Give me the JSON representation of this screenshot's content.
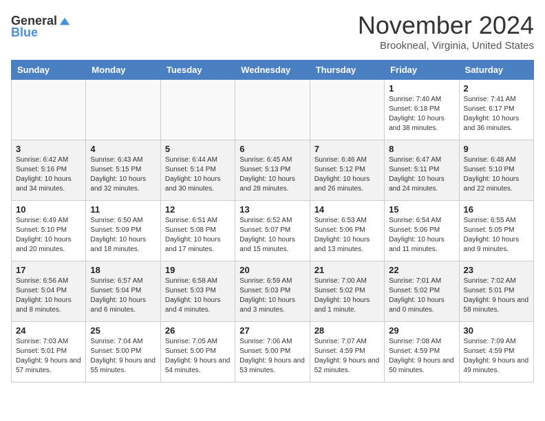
{
  "header": {
    "logo_general": "General",
    "logo_blue": "Blue",
    "month_title": "November 2024",
    "location": "Brookneal, Virginia, United States"
  },
  "weekdays": [
    "Sunday",
    "Monday",
    "Tuesday",
    "Wednesday",
    "Thursday",
    "Friday",
    "Saturday"
  ],
  "weeks": [
    [
      {
        "day": "",
        "sunrise": "",
        "sunset": "",
        "daylight": ""
      },
      {
        "day": "",
        "sunrise": "",
        "sunset": "",
        "daylight": ""
      },
      {
        "day": "",
        "sunrise": "",
        "sunset": "",
        "daylight": ""
      },
      {
        "day": "",
        "sunrise": "",
        "sunset": "",
        "daylight": ""
      },
      {
        "day": "",
        "sunrise": "",
        "sunset": "",
        "daylight": ""
      },
      {
        "day": "1",
        "sunrise": "Sunrise: 7:40 AM",
        "sunset": "Sunset: 6:18 PM",
        "daylight": "Daylight: 10 hours and 38 minutes."
      },
      {
        "day": "2",
        "sunrise": "Sunrise: 7:41 AM",
        "sunset": "Sunset: 6:17 PM",
        "daylight": "Daylight: 10 hours and 36 minutes."
      }
    ],
    [
      {
        "day": "3",
        "sunrise": "Sunrise: 6:42 AM",
        "sunset": "Sunset: 5:16 PM",
        "daylight": "Daylight: 10 hours and 34 minutes."
      },
      {
        "day": "4",
        "sunrise": "Sunrise: 6:43 AM",
        "sunset": "Sunset: 5:15 PM",
        "daylight": "Daylight: 10 hours and 32 minutes."
      },
      {
        "day": "5",
        "sunrise": "Sunrise: 6:44 AM",
        "sunset": "Sunset: 5:14 PM",
        "daylight": "Daylight: 10 hours and 30 minutes."
      },
      {
        "day": "6",
        "sunrise": "Sunrise: 6:45 AM",
        "sunset": "Sunset: 5:13 PM",
        "daylight": "Daylight: 10 hours and 28 minutes."
      },
      {
        "day": "7",
        "sunrise": "Sunrise: 6:46 AM",
        "sunset": "Sunset: 5:12 PM",
        "daylight": "Daylight: 10 hours and 26 minutes."
      },
      {
        "day": "8",
        "sunrise": "Sunrise: 6:47 AM",
        "sunset": "Sunset: 5:11 PM",
        "daylight": "Daylight: 10 hours and 24 minutes."
      },
      {
        "day": "9",
        "sunrise": "Sunrise: 6:48 AM",
        "sunset": "Sunset: 5:10 PM",
        "daylight": "Daylight: 10 hours and 22 minutes."
      }
    ],
    [
      {
        "day": "10",
        "sunrise": "Sunrise: 6:49 AM",
        "sunset": "Sunset: 5:10 PM",
        "daylight": "Daylight: 10 hours and 20 minutes."
      },
      {
        "day": "11",
        "sunrise": "Sunrise: 6:50 AM",
        "sunset": "Sunset: 5:09 PM",
        "daylight": "Daylight: 10 hours and 18 minutes."
      },
      {
        "day": "12",
        "sunrise": "Sunrise: 6:51 AM",
        "sunset": "Sunset: 5:08 PM",
        "daylight": "Daylight: 10 hours and 17 minutes."
      },
      {
        "day": "13",
        "sunrise": "Sunrise: 6:52 AM",
        "sunset": "Sunset: 5:07 PM",
        "daylight": "Daylight: 10 hours and 15 minutes."
      },
      {
        "day": "14",
        "sunrise": "Sunrise: 6:53 AM",
        "sunset": "Sunset: 5:06 PM",
        "daylight": "Daylight: 10 hours and 13 minutes."
      },
      {
        "day": "15",
        "sunrise": "Sunrise: 6:54 AM",
        "sunset": "Sunset: 5:06 PM",
        "daylight": "Daylight: 10 hours and 11 minutes."
      },
      {
        "day": "16",
        "sunrise": "Sunrise: 6:55 AM",
        "sunset": "Sunset: 5:05 PM",
        "daylight": "Daylight: 10 hours and 9 minutes."
      }
    ],
    [
      {
        "day": "17",
        "sunrise": "Sunrise: 6:56 AM",
        "sunset": "Sunset: 5:04 PM",
        "daylight": "Daylight: 10 hours and 8 minutes."
      },
      {
        "day": "18",
        "sunrise": "Sunrise: 6:57 AM",
        "sunset": "Sunset: 5:04 PM",
        "daylight": "Daylight: 10 hours and 6 minutes."
      },
      {
        "day": "19",
        "sunrise": "Sunrise: 6:58 AM",
        "sunset": "Sunset: 5:03 PM",
        "daylight": "Daylight: 10 hours and 4 minutes."
      },
      {
        "day": "20",
        "sunrise": "Sunrise: 6:59 AM",
        "sunset": "Sunset: 5:03 PM",
        "daylight": "Daylight: 10 hours and 3 minutes."
      },
      {
        "day": "21",
        "sunrise": "Sunrise: 7:00 AM",
        "sunset": "Sunset: 5:02 PM",
        "daylight": "Daylight: 10 hours and 1 minute."
      },
      {
        "day": "22",
        "sunrise": "Sunrise: 7:01 AM",
        "sunset": "Sunset: 5:02 PM",
        "daylight": "Daylight: 10 hours and 0 minutes."
      },
      {
        "day": "23",
        "sunrise": "Sunrise: 7:02 AM",
        "sunset": "Sunset: 5:01 PM",
        "daylight": "Daylight: 9 hours and 58 minutes."
      }
    ],
    [
      {
        "day": "24",
        "sunrise": "Sunrise: 7:03 AM",
        "sunset": "Sunset: 5:01 PM",
        "daylight": "Daylight: 9 hours and 57 minutes."
      },
      {
        "day": "25",
        "sunrise": "Sunrise: 7:04 AM",
        "sunset": "Sunset: 5:00 PM",
        "daylight": "Daylight: 9 hours and 55 minutes."
      },
      {
        "day": "26",
        "sunrise": "Sunrise: 7:05 AM",
        "sunset": "Sunset: 5:00 PM",
        "daylight": "Daylight: 9 hours and 54 minutes."
      },
      {
        "day": "27",
        "sunrise": "Sunrise: 7:06 AM",
        "sunset": "Sunset: 5:00 PM",
        "daylight": "Daylight: 9 hours and 53 minutes."
      },
      {
        "day": "28",
        "sunrise": "Sunrise: 7:07 AM",
        "sunset": "Sunset: 4:59 PM",
        "daylight": "Daylight: 9 hours and 52 minutes."
      },
      {
        "day": "29",
        "sunrise": "Sunrise: 7:08 AM",
        "sunset": "Sunset: 4:59 PM",
        "daylight": "Daylight: 9 hours and 50 minutes."
      },
      {
        "day": "30",
        "sunrise": "Sunrise: 7:09 AM",
        "sunset": "Sunset: 4:59 PM",
        "daylight": "Daylight: 9 hours and 49 minutes."
      }
    ]
  ]
}
